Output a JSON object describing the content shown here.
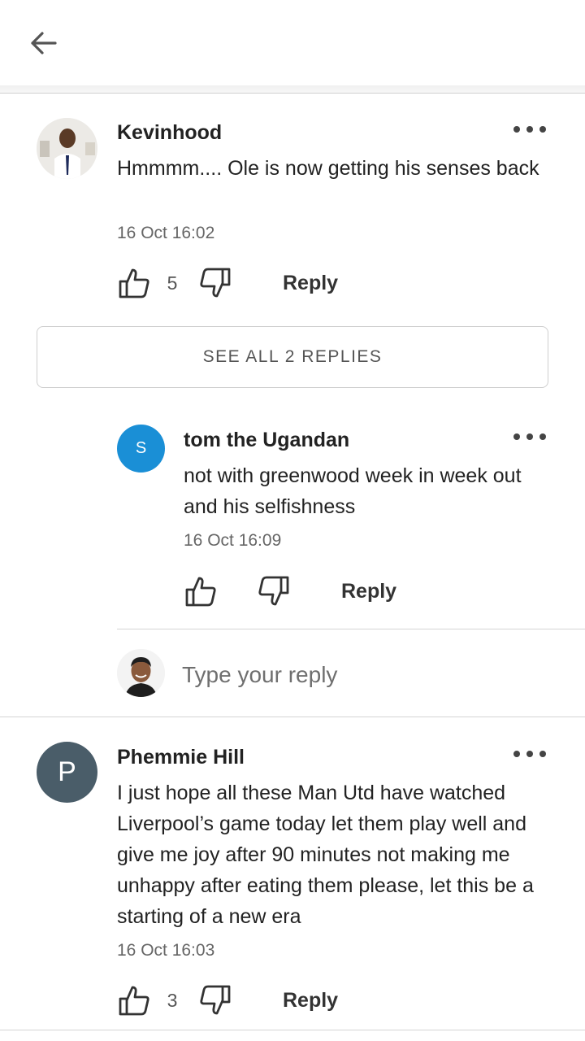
{
  "header": {
    "back_icon": "arrow-left-icon"
  },
  "comments": [
    {
      "author": "Kevinhood",
      "text": "Hmmmm.... Ole is now getting his senses back",
      "timestamp": "16 Oct 16:02",
      "likes": "5",
      "reply_label": "Reply"
    },
    {
      "author": "Phemmie Hill",
      "avatar_letter": "P",
      "avatar_color": "#4a5d69",
      "text": "I just hope all these Man Utd have watched Liverpool’s game today let them play well and give me joy after 90 minutes not making me unhappy after eating them please, let this be a starting of a new era",
      "timestamp": "16 Oct 16:03",
      "likes": "3",
      "reply_label": "Reply"
    }
  ],
  "see_all": {
    "label": "SEE ALL 2 REPLIES"
  },
  "reply": {
    "author": "tom the Ugandan",
    "avatar_letter": "S",
    "avatar_color": "#1a8fd6",
    "text": "not with greenwood week in week out and his selfishness",
    "timestamp": "16 Oct 16:09",
    "reply_label": "Reply"
  },
  "reply_input": {
    "placeholder": "Type your reply"
  }
}
